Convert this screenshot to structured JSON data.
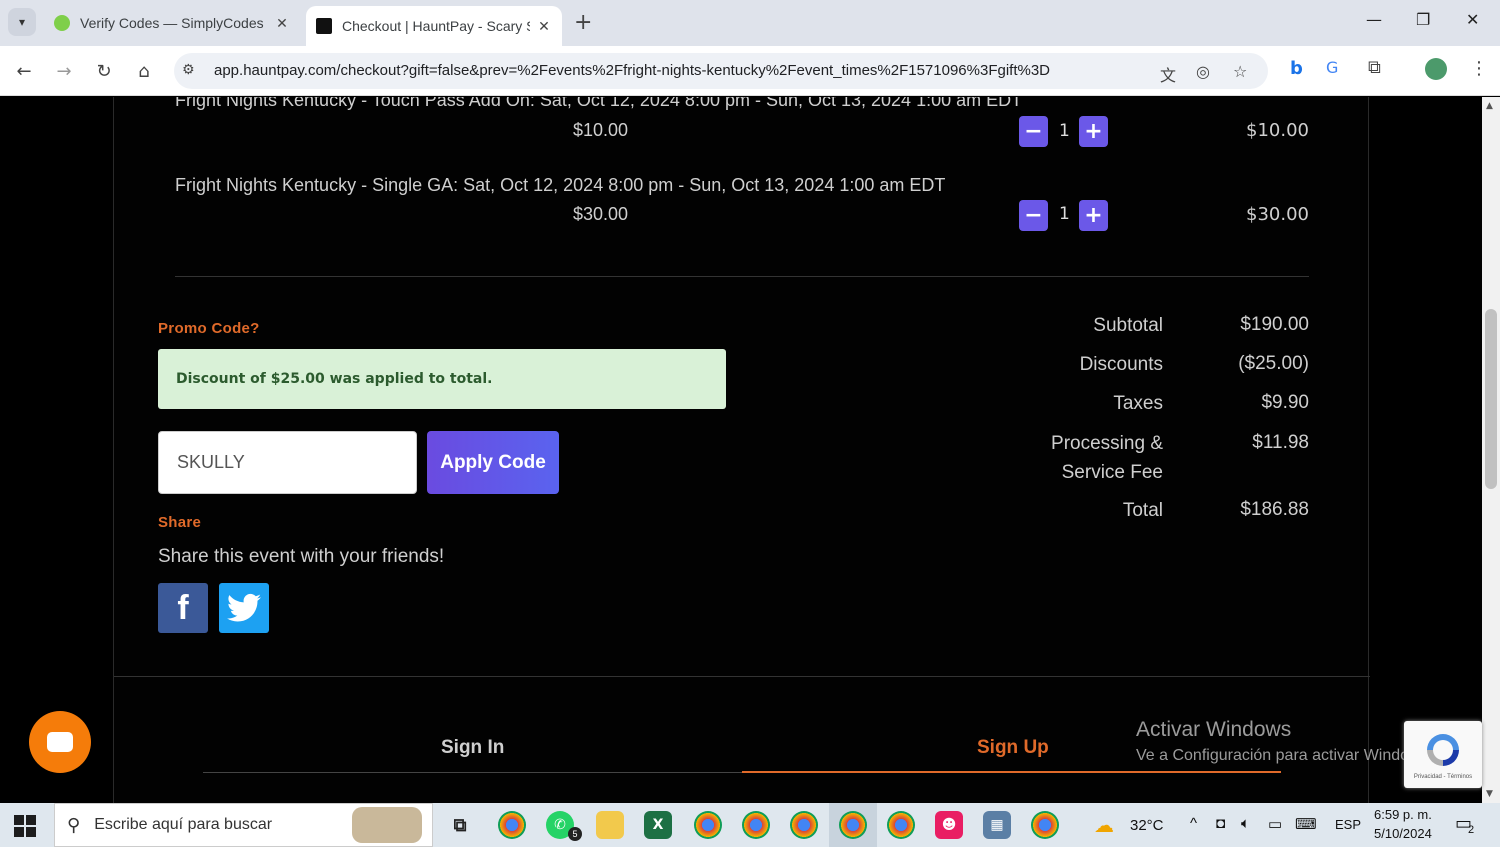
{
  "browser": {
    "tabs": [
      {
        "title": "Verify Codes — SimplyCodes",
        "active": false
      },
      {
        "title": "Checkout | HauntPay - Scary Sir",
        "active": true
      }
    ],
    "url": "app.hauntpay.com/checkout?gift=false&prev=%2Fevents%2Ffright-nights-kentucky%2Fevent_times%2F1571096%3Fgift%3D"
  },
  "cart": {
    "items": [
      {
        "title": "Fright Nights Kentucky - Touch Pass Add On: Sat, Oct 12, 2024 8:00 pm - Sun, Oct 13, 2024 1:00 am EDT",
        "price": "$10.00",
        "qty": "1",
        "line_total": "$10.00"
      },
      {
        "title": "Fright Nights Kentucky - Single GA: Sat, Oct 12, 2024 8:00 pm - Sun, Oct 13, 2024 1:00 am EDT",
        "price": "$30.00",
        "qty": "1",
        "line_total": "$30.00"
      }
    ]
  },
  "promo": {
    "label": "Promo Code?",
    "success_message": "Discount of $25.00 was applied to total.",
    "code_value": "SKULLY",
    "apply_label": "Apply Code"
  },
  "share": {
    "label": "Share",
    "subtitle": "Share this event with your friends!",
    "facebook_glyph": "f"
  },
  "summary": {
    "subtotal_label": "Subtotal",
    "subtotal_value": "$190.00",
    "discounts_label": "Discounts",
    "discounts_value": "($25.00)",
    "taxes_label": "Taxes",
    "taxes_value": "$9.90",
    "fee_label_1": "Processing &",
    "fee_label_2": "Service Fee",
    "fee_value": "$11.98",
    "total_label": "Total",
    "total_value": "$186.88"
  },
  "auth": {
    "sign_in": "Sign In",
    "sign_up": "Sign Up"
  },
  "watermark": {
    "title": "Activar Windows",
    "subtitle": "Ve a Configuración para activar Windows."
  },
  "recaptcha": {
    "terms": "Privacidad - Términos"
  },
  "taskbar": {
    "search_placeholder": "Escribe aquí para buscar",
    "whatsapp_badge": "5",
    "weather": "32°C",
    "lang": "ESP",
    "time": "6:59 p. m.",
    "date": "5/10/2024",
    "notifications": "2"
  },
  "colors": {
    "accent_orange": "#e06a2a",
    "button_purple": "#6b58e8",
    "success_bg": "#d9f1d7",
    "facebook": "#3b5998",
    "twitter": "#1da1f2"
  }
}
